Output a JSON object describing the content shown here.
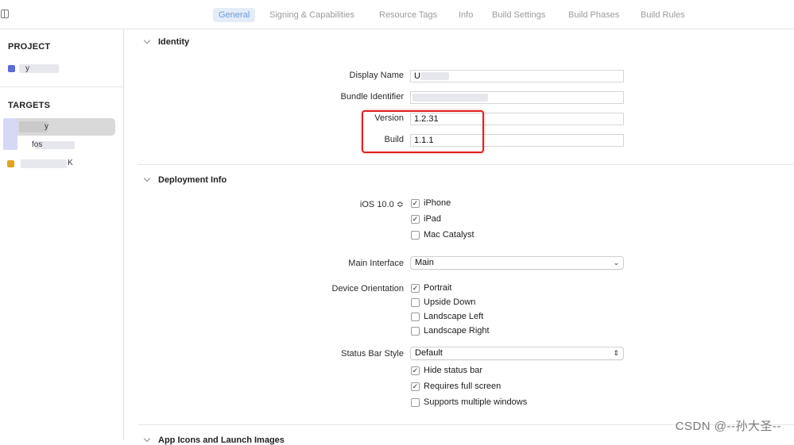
{
  "tabs": [
    {
      "label": "General",
      "active": true
    },
    {
      "label": "Signing & Capabilities"
    },
    {
      "label": "Resource Tags"
    },
    {
      "label": "Info"
    },
    {
      "label": "Build Settings"
    },
    {
      "label": "Build Phases"
    },
    {
      "label": "Build Rules"
    }
  ],
  "sidebar": {
    "project_header": "PROJECT",
    "project_item": "y",
    "targets_header": "TARGETS",
    "targets": [
      {
        "label": "y"
      },
      {
        "label": "fos"
      },
      {
        "label": "K"
      }
    ]
  },
  "identity": {
    "header": "Identity",
    "display_name_label": "Display Name",
    "display_name_value": "U",
    "bundle_id_label": "Bundle Identifier",
    "bundle_id_value": "",
    "version_label": "Version",
    "version_value": "1.2.31",
    "build_label": "Build",
    "build_value": "1.1.1"
  },
  "deployment": {
    "header": "Deployment Info",
    "ios_version": "iOS 10.0 ≎",
    "devices": [
      {
        "label": "iPhone",
        "checked": true
      },
      {
        "label": "iPad",
        "checked": true
      },
      {
        "label": "Mac Catalyst",
        "checked": false
      }
    ],
    "main_interface_label": "Main Interface",
    "main_interface_value": "Main",
    "orientation_label": "Device Orientation",
    "orientations": [
      {
        "label": "Portrait",
        "checked": true
      },
      {
        "label": "Upside Down",
        "checked": false
      },
      {
        "label": "Landscape Left",
        "checked": false
      },
      {
        "label": "Landscape Right",
        "checked": false
      }
    ],
    "status_bar_label": "Status Bar Style",
    "status_bar_value": "Default",
    "status_options": [
      {
        "label": "Hide status bar",
        "checked": true
      },
      {
        "label": "Requires full screen",
        "checked": true
      },
      {
        "label": "Supports multiple windows",
        "checked": false
      }
    ]
  },
  "next_section_header": "App Icons and Launch Images",
  "watermark": "CSDN @--孙大圣--",
  "colors": {
    "accent": "#6c9bd6",
    "highlight": "#e02020",
    "selected_row": "#d9d9d9"
  }
}
